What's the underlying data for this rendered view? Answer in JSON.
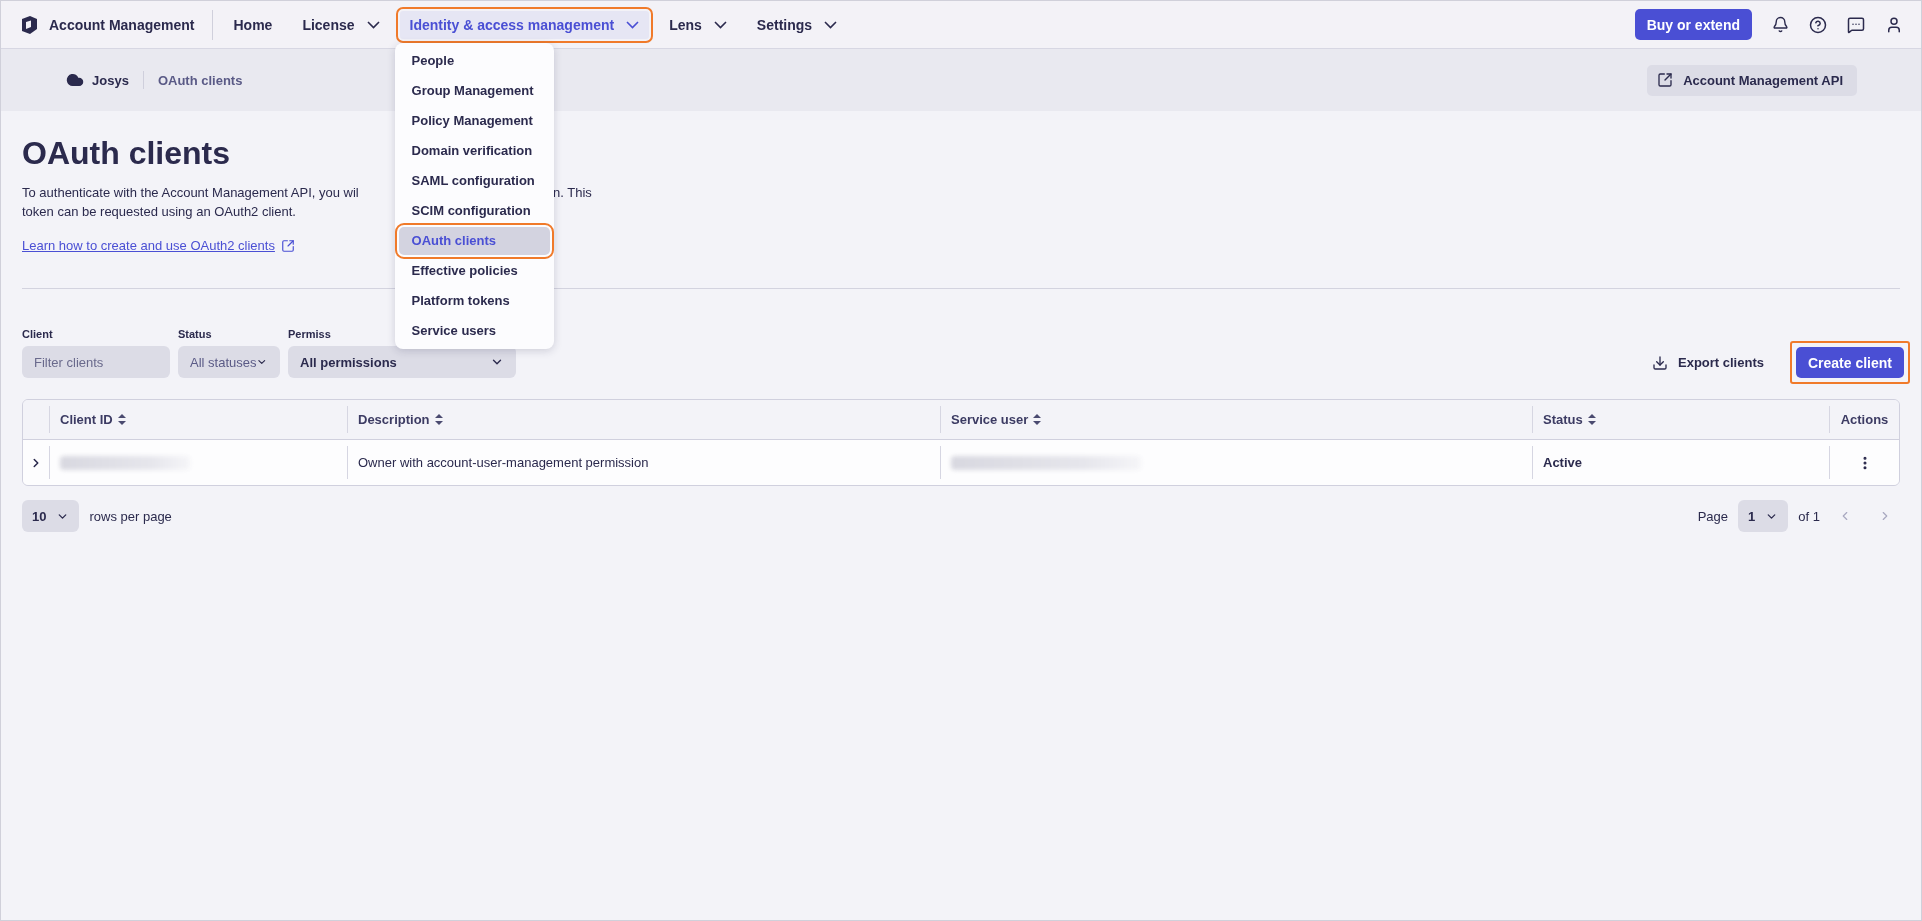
{
  "app": {
    "name": "Account Management"
  },
  "nav": [
    {
      "label": "Home",
      "has_menu": false,
      "selected": false,
      "highlighted": false
    },
    {
      "label": "License",
      "has_menu": true,
      "selected": false,
      "highlighted": false
    },
    {
      "label": "Identity & access management",
      "has_menu": true,
      "selected": true,
      "highlighted": true
    },
    {
      "label": "Lens",
      "has_menu": true,
      "selected": false,
      "highlighted": false
    },
    {
      "label": "Settings",
      "has_menu": true,
      "selected": false,
      "highlighted": false
    }
  ],
  "buy_button": "Buy or extend",
  "nav_menu": {
    "items": [
      {
        "label": "People",
        "selected": false,
        "highlighted": false
      },
      {
        "label": "Group Management",
        "selected": false,
        "highlighted": false
      },
      {
        "label": "Policy Management",
        "selected": false,
        "highlighted": false
      },
      {
        "label": "Domain verification",
        "selected": false,
        "highlighted": false
      },
      {
        "label": "SAML configuration",
        "selected": false,
        "highlighted": false
      },
      {
        "label": "SCIM configuration",
        "selected": false,
        "highlighted": false
      },
      {
        "label": "OAuth clients",
        "selected": true,
        "highlighted": true
      },
      {
        "label": "Effective policies",
        "selected": false,
        "highlighted": false
      },
      {
        "label": "Platform tokens",
        "selected": false,
        "highlighted": false
      },
      {
        "label": "Service users",
        "selected": false,
        "highlighted": false
      }
    ]
  },
  "breadcrumb": [
    {
      "label": "Josys",
      "kind": "root"
    },
    {
      "label": "OAuth clients",
      "kind": "page"
    }
  ],
  "api_button": "Account Management API",
  "page": {
    "title": "OAuth clients",
    "description_lines": [
      [
        "To authenticate with the Account Management API, you wil",
        "n. This"
      ],
      [
        "token can be requested using an OAuth2 client."
      ]
    ],
    "learn_link": "Learn how to create and use OAuth2 clients"
  },
  "filters": [
    {
      "label": "Client",
      "kind": "text",
      "placeholder": "Filter clients"
    },
    {
      "label": "Status",
      "kind": "select",
      "value": "All statuses"
    },
    {
      "label": "Permiss",
      "kind": "select",
      "value": "All permissions"
    }
  ],
  "export_button": "Export clients",
  "create_button": {
    "label": "Create client",
    "highlighted": true
  },
  "table": {
    "columns": [
      {
        "label": "Client ID",
        "sortable": true
      },
      {
        "label": "Description",
        "sortable": true
      },
      {
        "label": "Service user",
        "sortable": true
      },
      {
        "label": "Status",
        "sortable": true
      },
      {
        "label": "Actions",
        "sortable": false
      }
    ],
    "rows": [
      {
        "expanded": false,
        "description": "Owner with account-user-management permission",
        "status": "Active"
      }
    ]
  },
  "pagination": {
    "page_size": "10",
    "rows_label": "rows per page",
    "page_label": "Page",
    "page": "1",
    "of": "of 1",
    "prev_disabled": true,
    "next_disabled": true
  }
}
